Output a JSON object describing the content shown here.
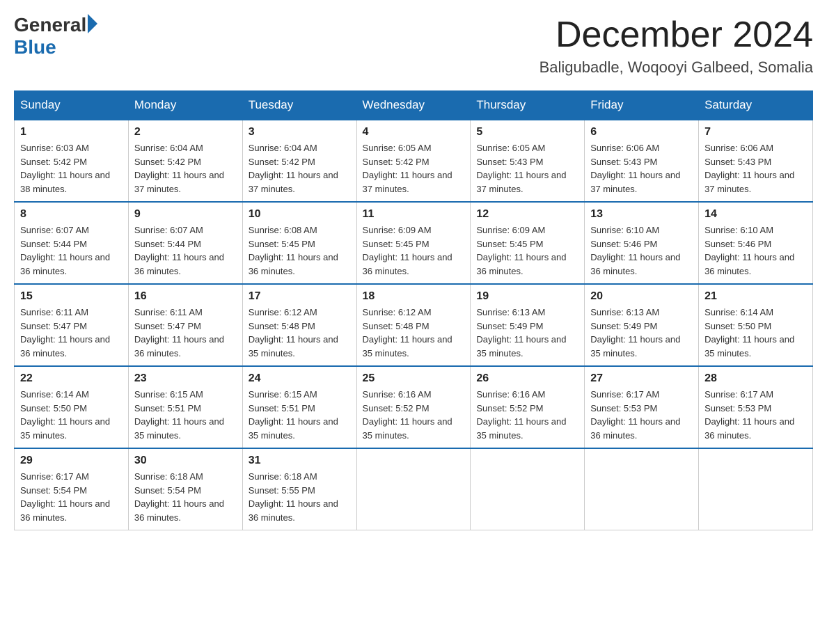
{
  "logo": {
    "general": "General",
    "blue": "Blue"
  },
  "header": {
    "month": "December 2024",
    "location": "Baligubadle, Woqooyi Galbeed, Somalia"
  },
  "days_of_week": [
    "Sunday",
    "Monday",
    "Tuesday",
    "Wednesday",
    "Thursday",
    "Friday",
    "Saturday"
  ],
  "weeks": [
    [
      {
        "day": "1",
        "sunrise": "6:03 AM",
        "sunset": "5:42 PM",
        "daylight": "11 hours and 38 minutes."
      },
      {
        "day": "2",
        "sunrise": "6:04 AM",
        "sunset": "5:42 PM",
        "daylight": "11 hours and 37 minutes."
      },
      {
        "day": "3",
        "sunrise": "6:04 AM",
        "sunset": "5:42 PM",
        "daylight": "11 hours and 37 minutes."
      },
      {
        "day": "4",
        "sunrise": "6:05 AM",
        "sunset": "5:42 PM",
        "daylight": "11 hours and 37 minutes."
      },
      {
        "day": "5",
        "sunrise": "6:05 AM",
        "sunset": "5:43 PM",
        "daylight": "11 hours and 37 minutes."
      },
      {
        "day": "6",
        "sunrise": "6:06 AM",
        "sunset": "5:43 PM",
        "daylight": "11 hours and 37 minutes."
      },
      {
        "day": "7",
        "sunrise": "6:06 AM",
        "sunset": "5:43 PM",
        "daylight": "11 hours and 37 minutes."
      }
    ],
    [
      {
        "day": "8",
        "sunrise": "6:07 AM",
        "sunset": "5:44 PM",
        "daylight": "11 hours and 36 minutes."
      },
      {
        "day": "9",
        "sunrise": "6:07 AM",
        "sunset": "5:44 PM",
        "daylight": "11 hours and 36 minutes."
      },
      {
        "day": "10",
        "sunrise": "6:08 AM",
        "sunset": "5:45 PM",
        "daylight": "11 hours and 36 minutes."
      },
      {
        "day": "11",
        "sunrise": "6:09 AM",
        "sunset": "5:45 PM",
        "daylight": "11 hours and 36 minutes."
      },
      {
        "day": "12",
        "sunrise": "6:09 AM",
        "sunset": "5:45 PM",
        "daylight": "11 hours and 36 minutes."
      },
      {
        "day": "13",
        "sunrise": "6:10 AM",
        "sunset": "5:46 PM",
        "daylight": "11 hours and 36 minutes."
      },
      {
        "day": "14",
        "sunrise": "6:10 AM",
        "sunset": "5:46 PM",
        "daylight": "11 hours and 36 minutes."
      }
    ],
    [
      {
        "day": "15",
        "sunrise": "6:11 AM",
        "sunset": "5:47 PM",
        "daylight": "11 hours and 36 minutes."
      },
      {
        "day": "16",
        "sunrise": "6:11 AM",
        "sunset": "5:47 PM",
        "daylight": "11 hours and 36 minutes."
      },
      {
        "day": "17",
        "sunrise": "6:12 AM",
        "sunset": "5:48 PM",
        "daylight": "11 hours and 35 minutes."
      },
      {
        "day": "18",
        "sunrise": "6:12 AM",
        "sunset": "5:48 PM",
        "daylight": "11 hours and 35 minutes."
      },
      {
        "day": "19",
        "sunrise": "6:13 AM",
        "sunset": "5:49 PM",
        "daylight": "11 hours and 35 minutes."
      },
      {
        "day": "20",
        "sunrise": "6:13 AM",
        "sunset": "5:49 PM",
        "daylight": "11 hours and 35 minutes."
      },
      {
        "day": "21",
        "sunrise": "6:14 AM",
        "sunset": "5:50 PM",
        "daylight": "11 hours and 35 minutes."
      }
    ],
    [
      {
        "day": "22",
        "sunrise": "6:14 AM",
        "sunset": "5:50 PM",
        "daylight": "11 hours and 35 minutes."
      },
      {
        "day": "23",
        "sunrise": "6:15 AM",
        "sunset": "5:51 PM",
        "daylight": "11 hours and 35 minutes."
      },
      {
        "day": "24",
        "sunrise": "6:15 AM",
        "sunset": "5:51 PM",
        "daylight": "11 hours and 35 minutes."
      },
      {
        "day": "25",
        "sunrise": "6:16 AM",
        "sunset": "5:52 PM",
        "daylight": "11 hours and 35 minutes."
      },
      {
        "day": "26",
        "sunrise": "6:16 AM",
        "sunset": "5:52 PM",
        "daylight": "11 hours and 35 minutes."
      },
      {
        "day": "27",
        "sunrise": "6:17 AM",
        "sunset": "5:53 PM",
        "daylight": "11 hours and 36 minutes."
      },
      {
        "day": "28",
        "sunrise": "6:17 AM",
        "sunset": "5:53 PM",
        "daylight": "11 hours and 36 minutes."
      }
    ],
    [
      {
        "day": "29",
        "sunrise": "6:17 AM",
        "sunset": "5:54 PM",
        "daylight": "11 hours and 36 minutes."
      },
      {
        "day": "30",
        "sunrise": "6:18 AM",
        "sunset": "5:54 PM",
        "daylight": "11 hours and 36 minutes."
      },
      {
        "day": "31",
        "sunrise": "6:18 AM",
        "sunset": "5:55 PM",
        "daylight": "11 hours and 36 minutes."
      },
      null,
      null,
      null,
      null
    ]
  ]
}
